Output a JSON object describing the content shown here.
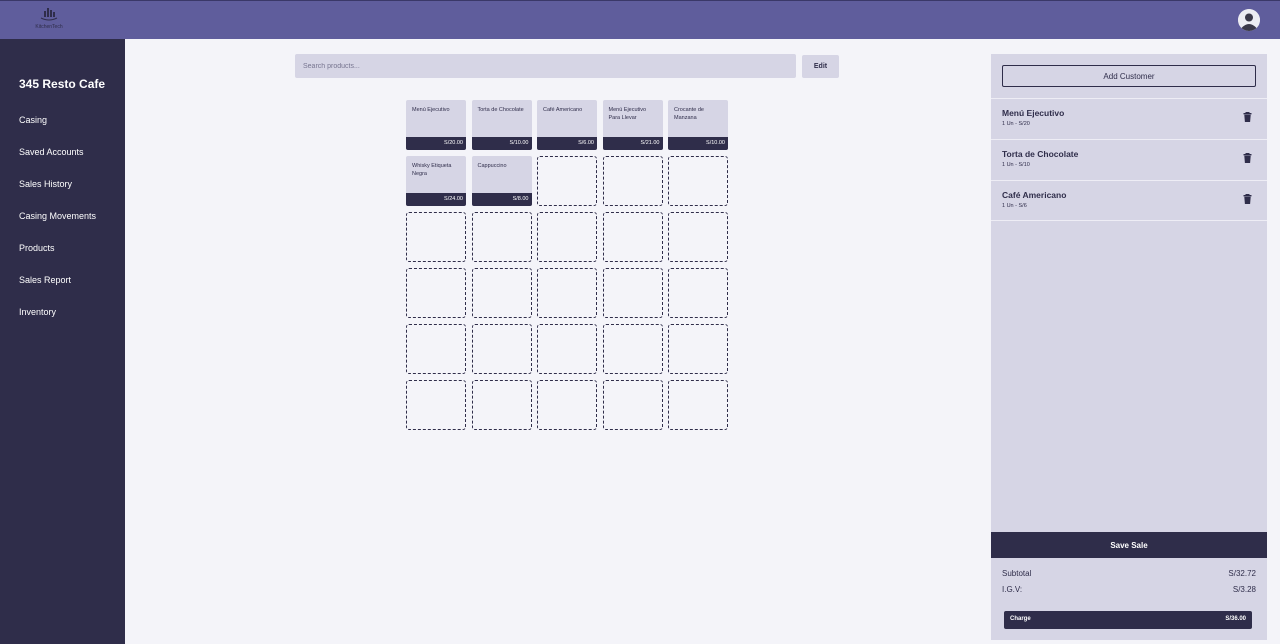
{
  "header": {
    "logo_text": "KitchenTech",
    "avatar_icon": "user-avatar-icon",
    "colors": {
      "topbar": "#5f5d9c",
      "dark": "#2f2d4a",
      "panel": "#d6d5e5",
      "background": "#f4f4f9"
    }
  },
  "sidebar": {
    "brand": "345 Resto Cafe",
    "items": [
      {
        "label": "Casing"
      },
      {
        "label": "Saved Accounts"
      },
      {
        "label": "Sales History"
      },
      {
        "label": "Casing Movements"
      },
      {
        "label": "Products"
      },
      {
        "label": "Sales Report"
      },
      {
        "label": "Inventory"
      }
    ]
  },
  "search": {
    "placeholder": "Search products...",
    "value": ""
  },
  "edit_label": "Edit",
  "products": [
    {
      "name": "Menú Ejecutivo",
      "price": "S/20.00"
    },
    {
      "name": "Torta de Chocolate",
      "price": "S/10.00"
    },
    {
      "name": "Café Americano",
      "price": "S/6.00"
    },
    {
      "name": "Menú Ejecutivo Para Llevar",
      "price": "S/21.00"
    },
    {
      "name": "Crocante de Manzana",
      "price": "S/10.00"
    },
    {
      "name": "Whisky Etiqueta Negra",
      "price": "S/24.00"
    },
    {
      "name": "Cappuccino",
      "price": "S/8.00"
    }
  ],
  "empty_slots": 23,
  "cart": {
    "add_customer": "Add Customer",
    "items": [
      {
        "name": "Menú Ejecutivo",
        "detail": "1 Un - S/20"
      },
      {
        "name": "Torta de Chocolate",
        "detail": "1 Un - S/10"
      },
      {
        "name": "Café Americano",
        "detail": "1 Un - S/6"
      }
    ],
    "save_sale": "Save Sale",
    "subtotal_label": "Subtotal",
    "subtotal": "S/32.72",
    "igv_label": "I.G.V:",
    "igv": "S/3.28",
    "charge_label": "Charge",
    "charge_amount": "S/36.00"
  }
}
